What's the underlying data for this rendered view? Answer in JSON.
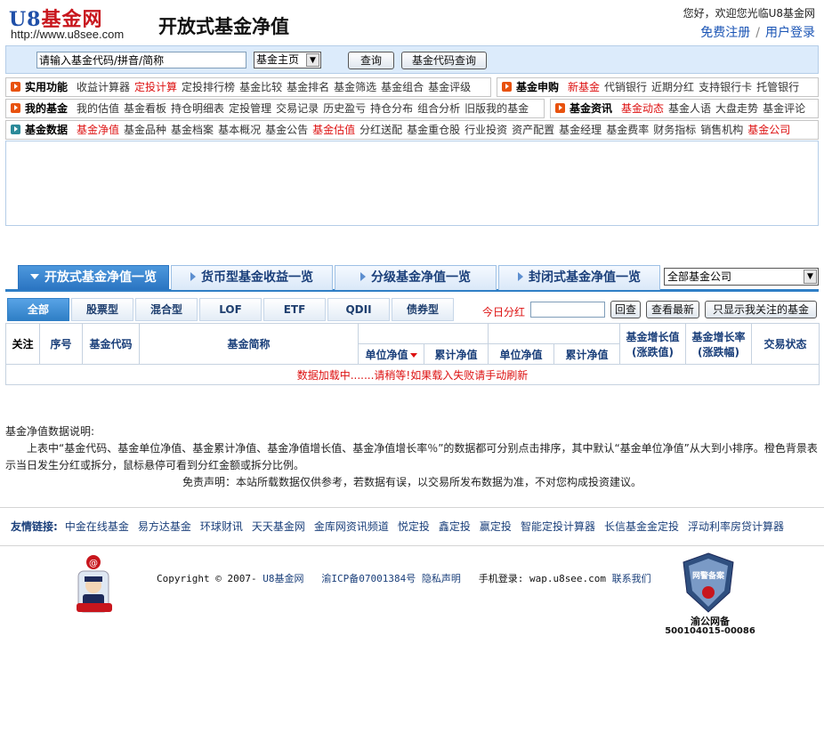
{
  "header": {
    "logo_u8": "U8",
    "logo_cn": "基金网",
    "logo_url": "http://www.u8see.com",
    "title": "开放式基金净值",
    "welcome": "您好，欢迎您光临U8基金网",
    "register": "免费注册",
    "separator": "/",
    "login": "用户登录"
  },
  "search": {
    "input_value": "请输入基金代码/拼音/简称",
    "select_value": "基金主页",
    "query_button": "查询",
    "fundcode_button": "基金代码查询"
  },
  "nav": {
    "practical": {
      "head": "实用功能",
      "links": [
        {
          "label": "收益计算器",
          "red": false
        },
        {
          "label": "定投计算",
          "red": true
        },
        {
          "label": "定投排行榜",
          "red": false
        },
        {
          "label": "基金比较",
          "red": false
        },
        {
          "label": "基金排名",
          "red": false
        },
        {
          "label": "基金筛选",
          "red": false
        },
        {
          "label": "基金组合",
          "red": false
        },
        {
          "label": "基金评级",
          "red": false
        }
      ]
    },
    "purchase": {
      "head": "基金申购",
      "links": [
        {
          "label": "新基金",
          "red": true
        },
        {
          "label": "代销银行",
          "red": false
        },
        {
          "label": "近期分红",
          "red": false
        },
        {
          "label": "支持银行卡",
          "red": false
        },
        {
          "label": "托管银行",
          "red": false
        }
      ]
    },
    "my_fund": {
      "head": "我的基金",
      "links": [
        {
          "label": "我的估值",
          "red": false
        },
        {
          "label": "基金看板",
          "red": false
        },
        {
          "label": "持仓明细表",
          "red": false
        },
        {
          "label": "定投管理",
          "red": false
        },
        {
          "label": "交易记录",
          "red": false
        },
        {
          "label": "历史盈亏",
          "red": false
        },
        {
          "label": "持仓分布",
          "red": false
        },
        {
          "label": "组合分析",
          "red": false
        },
        {
          "label": "旧版我的基金",
          "red": false
        }
      ]
    },
    "news": {
      "head": "基金资讯",
      "links": [
        {
          "label": "基金动态",
          "red": true
        },
        {
          "label": "基金人语",
          "red": false
        },
        {
          "label": "大盘走势",
          "red": false
        },
        {
          "label": "基金评论",
          "red": false
        }
      ]
    },
    "data": {
      "head": "基金数据",
      "links": [
        {
          "label": "基金净值",
          "red": true
        },
        {
          "label": "基金品种",
          "red": false
        },
        {
          "label": "基金档案",
          "red": false
        },
        {
          "label": "基本概况",
          "red": false
        },
        {
          "label": "基金公告",
          "red": false
        },
        {
          "label": "基金估值",
          "red": true
        },
        {
          "label": "分红送配",
          "red": false
        },
        {
          "label": "基金重仓股",
          "red": false
        },
        {
          "label": "行业投资",
          "red": false
        },
        {
          "label": "资产配置",
          "red": false
        },
        {
          "label": "基金经理",
          "red": false
        },
        {
          "label": "基金费率",
          "red": false
        },
        {
          "label": "财务指标",
          "red": false
        },
        {
          "label": "销售机构",
          "red": false
        },
        {
          "label": "基金公司",
          "red": true
        }
      ]
    }
  },
  "main_tabs": [
    {
      "label": "开放式基金净值一览",
      "active": true
    },
    {
      "label": "货币型基金收益一览",
      "active": false
    },
    {
      "label": "分级基金净值一览",
      "active": false
    },
    {
      "label": "封闭式基金净值一览",
      "active": false
    }
  ],
  "company_select": "全部基金公司",
  "sub_tabs": [
    {
      "label": "全部",
      "active": true
    },
    {
      "label": "股票型",
      "active": false
    },
    {
      "label": "混合型",
      "active": false
    },
    {
      "label": "LOF",
      "active": false
    },
    {
      "label": "ETF",
      "active": false
    },
    {
      "label": "QDII",
      "active": false
    },
    {
      "label": "债券型",
      "active": false
    }
  ],
  "toolbar": {
    "dividend_label": "今日分红",
    "confirm_button": "回查",
    "latest_button": "查看最新",
    "follow_button": "只显示我关注的基金"
  },
  "table": {
    "headers": {
      "follow": "关注",
      "seq": "序号",
      "code": "基金代码",
      "name": "基金简称",
      "unit_nav_1": "单位净值",
      "acc_nav_1": "累计净值",
      "unit_nav_2": "单位净值",
      "acc_nav_2": "累计净值",
      "growth_value": "基金增长值",
      "growth_value_sub": "(涨跌值)",
      "growth_rate": "基金增长率",
      "growth_rate_sub": "(涨跌幅)",
      "status": "交易状态"
    },
    "loading": "数据加载中.......请稍等!如果载入失败请手动刷新"
  },
  "notes": {
    "title": "基金净值数据说明:",
    "body": "上表中“基金代码、基金单位净值、基金累计净值、基金净值增长值、基金净值增长率％”的数据都可分别点击排序，其中默认“基金单位净值”从大到小排序。橙色背景表示当日发生分红或拆分，鼠标悬停可看到分红金额或拆分比例。",
    "disclaimer": "免责声明：本站所载数据仅供参考，若数据有误，以交易所发布数据为准，不对您构成投资建议。"
  },
  "friend_links": {
    "label": "友情链接:",
    "links": [
      "中金在线基金",
      "易方达基金",
      "环球财讯",
      "天天基金网",
      "金库网资讯频道",
      "悦定投",
      "鑫定投",
      "赢定投",
      "智能定投计算器",
      "长信基金金定投",
      "浮动利率房贷计算器"
    ]
  },
  "footer": {
    "copyright_prefix": "Copyright © 2007-",
    "site_name": "U8基金网",
    "icp": "渝ICP备07001384号",
    "privacy": "隐私声明",
    "mobile_label": "手机登录:",
    "mobile_url": "wap.u8see.com",
    "contact": "联系我们",
    "badge_text": "网警备案",
    "badge_label": "渝公网备",
    "badge_number": "500104015-00086"
  },
  "colors": {
    "accent_blue": "#2f7fc6",
    "link_red": "#d11",
    "badge_orange": "#e8520e"
  }
}
